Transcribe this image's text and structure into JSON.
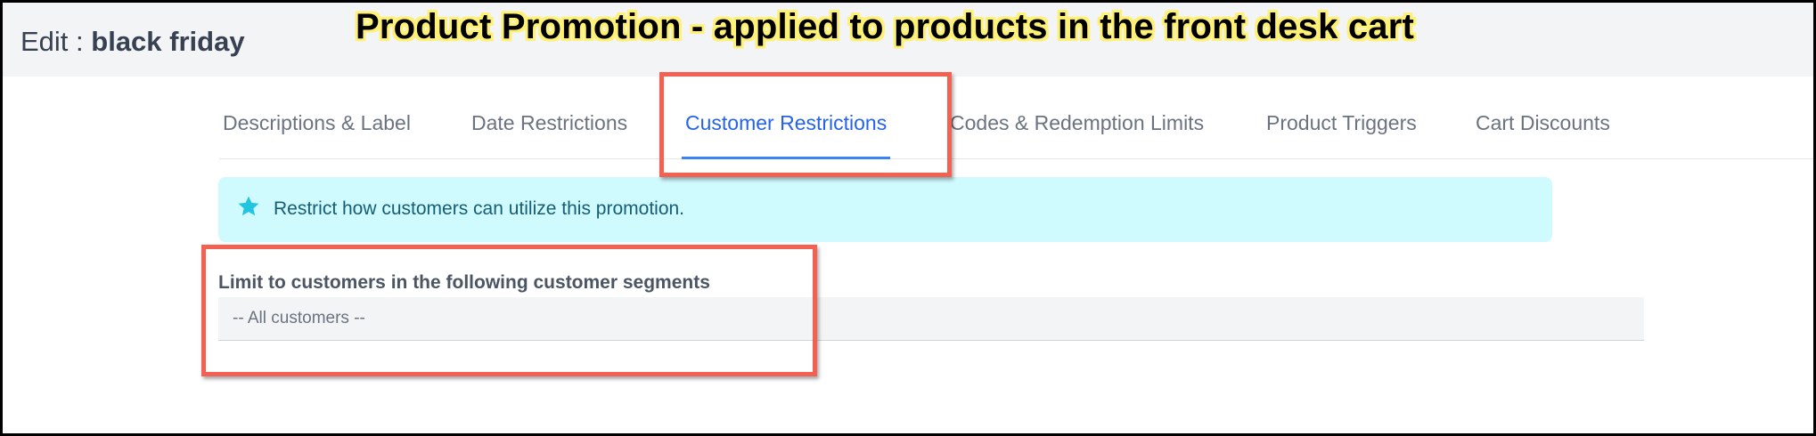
{
  "header": {
    "title_prefix": "Edit : ",
    "title_name": "black friday"
  },
  "annotation": {
    "banner_text": "Product Promotion - applied to products in the front desk cart",
    "highlight_color": "#fff176",
    "callout_color": "#f26151"
  },
  "tabs": [
    {
      "label": "Descriptions & Label",
      "active": false
    },
    {
      "label": "Date Restrictions",
      "active": false
    },
    {
      "label": "Customer Restrictions",
      "active": true
    },
    {
      "label": "Codes & Redemption Limits",
      "active": false
    },
    {
      "label": "Product Triggers",
      "active": false
    },
    {
      "label": "Cart Discounts",
      "active": false
    }
  ],
  "info": {
    "icon": "star-icon",
    "text": "Restrict how customers can utilize this promotion."
  },
  "segments": {
    "label": "Limit to customers in the following customer segments",
    "selected": "-- All customers --"
  },
  "colors": {
    "accent": "#2563eb",
    "info_bg": "#cffafe",
    "info_icon": "#22c5e0"
  }
}
